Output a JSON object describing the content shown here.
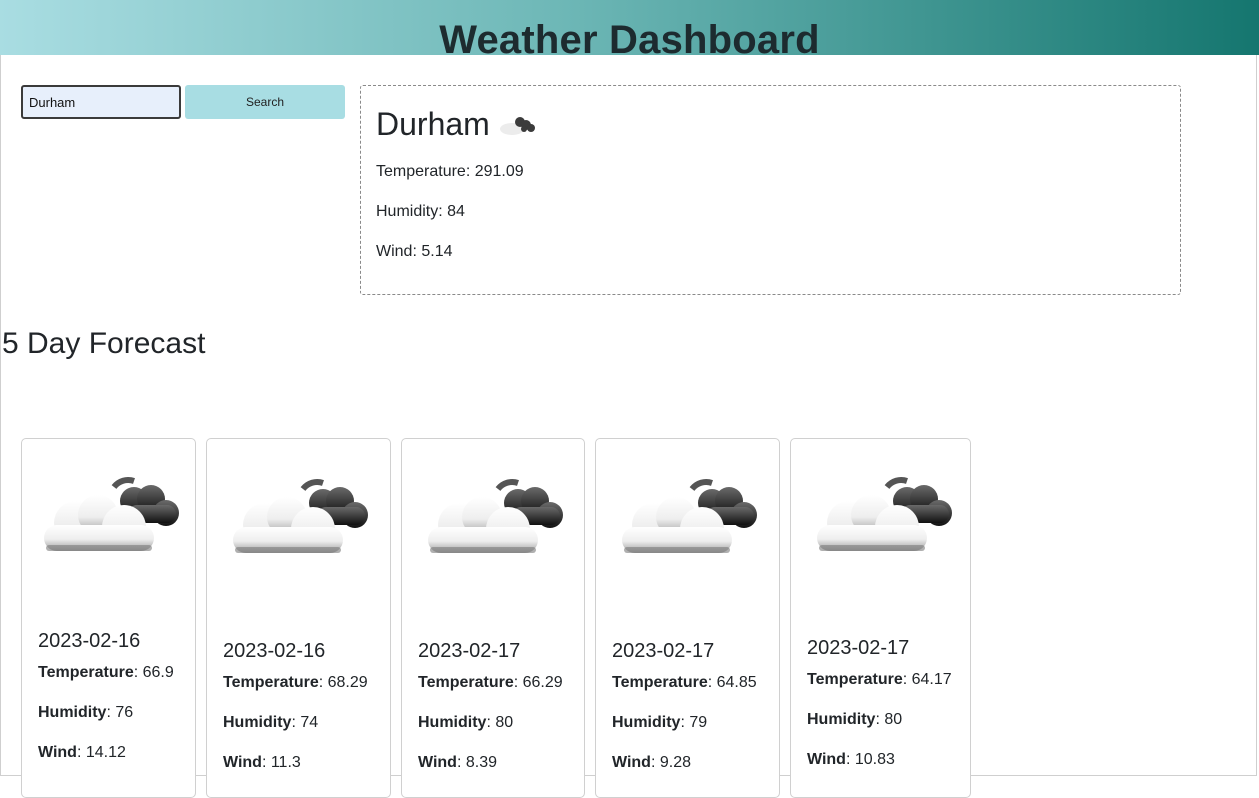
{
  "header": {
    "title": "Weather Dashboard"
  },
  "search": {
    "value": "Durham",
    "button_label": "Search"
  },
  "current": {
    "city": "Durham",
    "icon": "cloud-night-icon",
    "temperature_label": "Temperature:",
    "temperature": "291.09",
    "humidity_label": "Humidity:",
    "humidity": "84",
    "wind_label": "Wind:",
    "wind": "5.14"
  },
  "forecast": {
    "heading": "5 Day Forecast",
    "labels": {
      "temperature": "Temperature",
      "humidity": "Humidity",
      "wind": "Wind"
    },
    "days": [
      {
        "date": "2023-02-16",
        "temperature": "66.9",
        "humidity": "76",
        "wind": "14.12",
        "icon": "cloud-night-icon"
      },
      {
        "date": "2023-02-16",
        "temperature": "68.29",
        "humidity": "74",
        "wind": "11.3",
        "icon": "cloud-night-icon"
      },
      {
        "date": "2023-02-17",
        "temperature": "66.29",
        "humidity": "80",
        "wind": "8.39",
        "icon": "cloud-night-icon"
      },
      {
        "date": "2023-02-17",
        "temperature": "64.85",
        "humidity": "79",
        "wind": "9.28",
        "icon": "cloud-night-icon"
      },
      {
        "date": "2023-02-17",
        "temperature": "64.17",
        "humidity": "80",
        "wind": "10.83",
        "icon": "cloud-night-icon"
      }
    ]
  }
}
